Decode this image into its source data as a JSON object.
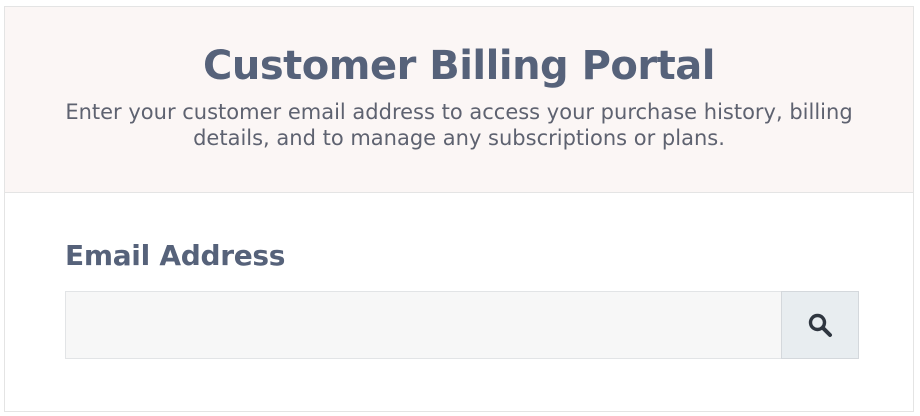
{
  "header": {
    "title": "Customer Billing Portal",
    "description": "Enter your customer email address to access your purchase history, billing details, and to manage any subscriptions or plans."
  },
  "form": {
    "email_label": "Email Address",
    "email_value": "",
    "email_placeholder": "",
    "search_icon": "search-icon"
  },
  "colors": {
    "header_background": "#fbf6f5",
    "heading_text": "#56627a",
    "body_text": "#5e6270",
    "input_background": "#f7f7f7",
    "button_background": "#e8edf0",
    "icon_color": "#2f3640"
  }
}
